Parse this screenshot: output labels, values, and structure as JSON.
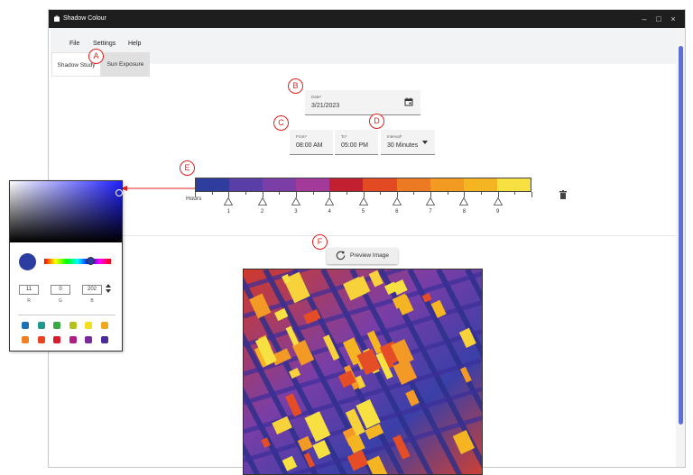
{
  "window": {
    "title": "Shadow Colour"
  },
  "menu": {
    "items": [
      "File",
      "Settings",
      "Help"
    ]
  },
  "tabs": [
    {
      "label": "Shadow Study",
      "active": true
    },
    {
      "label": "Sun Exposure",
      "active": false
    }
  ],
  "date_field": {
    "label": "Date*",
    "value": "3/21/2023"
  },
  "from_field": {
    "label": "From*",
    "value": "08:00 AM"
  },
  "to_field": {
    "label": "To*",
    "value": "05:00 PM"
  },
  "interval_field": {
    "label": "Interval*",
    "value": "30 Minutes"
  },
  "colorbar": {
    "title": "Hours",
    "segment_colors": [
      "#2f3e9e",
      "#5a3ea8",
      "#7a3ea6",
      "#a33a9a",
      "#c21f30",
      "#e24a24",
      "#ec7a22",
      "#f29a22",
      "#f5b522",
      "#f7e042"
    ],
    "hour_labels": [
      "1",
      "2",
      "3",
      "4",
      "5",
      "6",
      "7",
      "8",
      "9"
    ]
  },
  "preview_button": {
    "label": "Preview Image"
  },
  "callouts": [
    "A",
    "B",
    "C",
    "D",
    "E",
    "F"
  ],
  "picker": {
    "current_color": "#2b3da0",
    "r": "11",
    "g": "0",
    "b": "202",
    "r_label": "R",
    "g_label": "G",
    "b_label": "B",
    "palette": [
      "#1f6fb5",
      "#1f9a8a",
      "#3aa845",
      "#b5c21e",
      "#f2de1c",
      "#f0a91f",
      "#f08020",
      "#e64421",
      "#d81b2f",
      "#b01d80",
      "#7a2a9a",
      "#4a2c9a"
    ]
  },
  "accent": "#5e6fd6",
  "callout_color": "#e02020"
}
